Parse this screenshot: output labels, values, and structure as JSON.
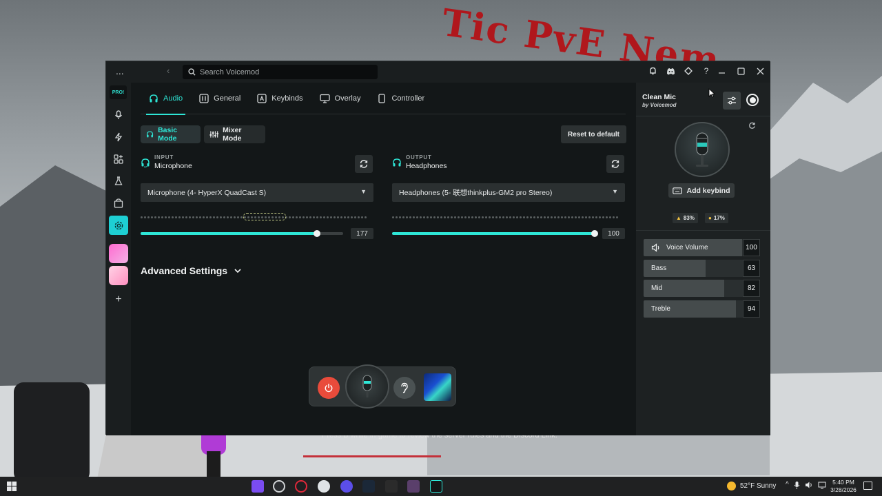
{
  "background": {
    "overlay_title": "Tic PvE Nem",
    "caption": "Press B while in-game to review the server rules and the Discord Link."
  },
  "titlebar": {
    "menu_glyph": "...",
    "back_glyph": "‹",
    "search_placeholder": "Search Voicemod",
    "icons": [
      "bell-icon",
      "discord-icon",
      "tag-icon",
      "help-icon"
    ],
    "help_glyph": "?",
    "window_controls": [
      "minimize",
      "maximize",
      "close"
    ]
  },
  "sidebar": {
    "logo_text": "PRO!",
    "items": [
      "microphone-icon",
      "lightning-icon",
      "apps-icon",
      "flask-icon",
      "store-icon",
      "settings-icon"
    ],
    "add_glyph": "+"
  },
  "tabs": [
    {
      "label": "Audio",
      "active": true
    },
    {
      "label": "General",
      "active": false
    },
    {
      "label": "Keybinds",
      "active": false
    },
    {
      "label": "Overlay",
      "active": false
    },
    {
      "label": "Controller",
      "active": false
    }
  ],
  "modes": {
    "basic": "Basic Mode",
    "mixer": "Mixer Mode",
    "reset": "Reset to default"
  },
  "input": {
    "label": "INPUT",
    "name": "Microphone",
    "device": "Microphone (4- HyperX QuadCast S)",
    "volume": "177",
    "level": 0.87
  },
  "output": {
    "label": "OUTPUT",
    "name": "Headphones",
    "device": "Headphones (5- 联想thinkplus-GM2 pro Stereo)",
    "volume": "100",
    "level": 1.0
  },
  "advanced": {
    "label": "Advanced Settings"
  },
  "voice": {
    "title": "Clean Mic",
    "by": "by Voicemod",
    "keybind": "Add keybind",
    "like": "83%",
    "dislike": "17%"
  },
  "eq": [
    {
      "label": "Voice Volume",
      "value": "100",
      "level": 1.0,
      "icon": "speaker-icon"
    },
    {
      "label": "Bass",
      "value": "63",
      "level": 0.63
    },
    {
      "label": "Mid",
      "value": "82",
      "level": 0.82
    },
    {
      "label": "Treble",
      "value": "94",
      "level": 0.94
    }
  ],
  "taskbar": {
    "weather": "52°F  Sunny",
    "time": "5:40 PM",
    "date": "3/28/2026"
  },
  "colors": {
    "accent": "#2ee6d6",
    "power": "#e94b3b",
    "bg_title": "#b0171c"
  }
}
